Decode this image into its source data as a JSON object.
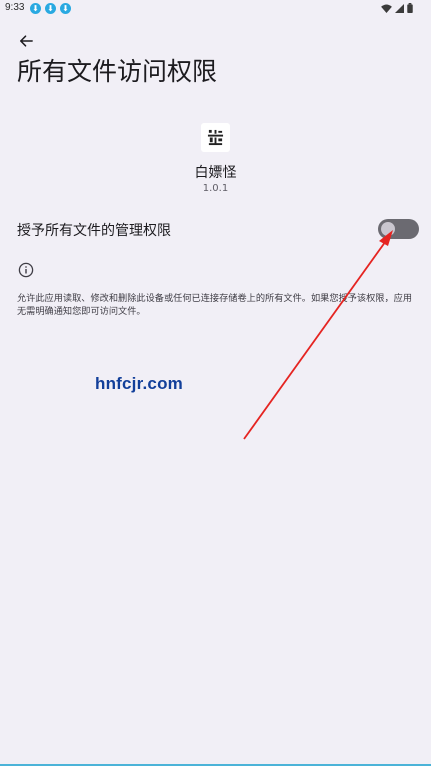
{
  "status_bar": {
    "time": "9:33",
    "notification_icons": [
      "download-icon",
      "download-icon",
      "download-icon"
    ],
    "system_icons": [
      "wifi-icon",
      "signal-icon",
      "battery-icon"
    ]
  },
  "header": {
    "back_icon": "arrow-back-icon",
    "title": "所有文件访问权限"
  },
  "app": {
    "name": "白嫖怪",
    "version": "1.0.1"
  },
  "permission": {
    "label": "授予所有文件的管理权限",
    "enabled": false
  },
  "info": {
    "icon": "info-icon",
    "description": "允许此应用读取、修改和删除此设备或任何已连接存储卷上的所有文件。如果您授予该权限，应用无需明确通知您即可访问文件。"
  },
  "watermark": "hnfcjr.com",
  "colors": {
    "background": "#f1eff6",
    "switch_track": "#6b6a71",
    "switch_thumb": "#c9c6cf",
    "annotation_arrow": "#e52421",
    "watermark": "#123f9a",
    "download_badge": "#29a9e1"
  }
}
